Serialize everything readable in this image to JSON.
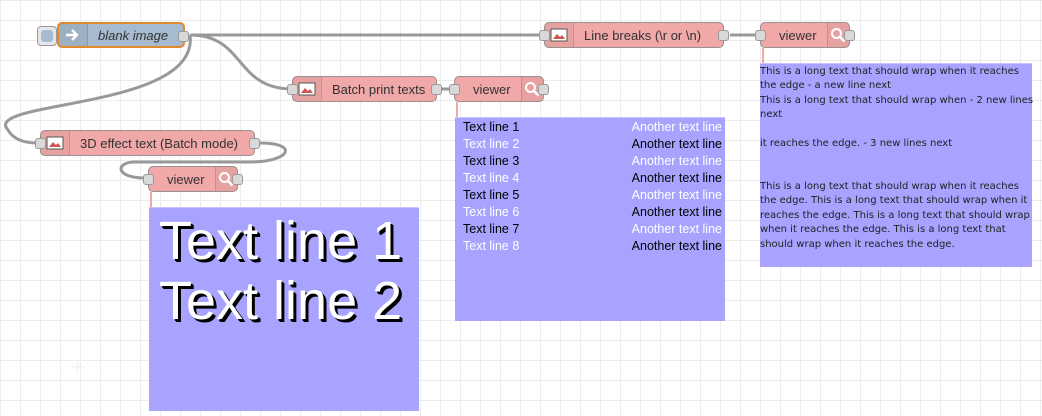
{
  "nodes": {
    "inject": {
      "label": "blank image",
      "icon": "arrow-right-icon"
    },
    "line_breaks": {
      "label": "Line breaks (\\r or \\n)",
      "icon": "image-icon"
    },
    "batch_print": {
      "label": "Batch print texts",
      "icon": "image-icon"
    },
    "effect_3d": {
      "label": "3D effect text (Batch mode)",
      "icon": "image-icon"
    },
    "viewer_1": {
      "label": "viewer",
      "icon": "search-icon"
    },
    "viewer_2": {
      "label": "viewer",
      "icon": "search-icon"
    },
    "viewer_3": {
      "label": "viewer",
      "icon": "search-icon"
    }
  },
  "viewer_3d": {
    "lines": [
      "Text line 1",
      "Text line 2"
    ]
  },
  "viewer_batch": {
    "left": [
      "Text line 1",
      "Text line 2",
      "Text line 3",
      "Text line 4",
      "Text line 5",
      "Text line 6",
      "Text line 7",
      "Text line 8"
    ],
    "right": [
      "Another text line",
      "Another text line",
      "Another text line",
      "Another text line",
      "Another text line",
      "Another text line",
      "Another text line",
      "Another text line"
    ]
  },
  "viewer_wrap": {
    "block1": "This is a long text that should wrap when it reaches the edge - a new line next",
    "block2": "This is a long text that should wrap when - 2 new lines next",
    "block3": "it reaches the edge. - 3 new lines next",
    "block4": "This is a long text that should wrap when it reaches the edge. This is a long text that should wrap when it reaches the edge. This is a long text that should wrap when it reaches the edge. This is a long text that should wrap when it reaches the edge."
  },
  "colors": {
    "node_function": "#f0a8a8",
    "node_inject": "#a6bbcf",
    "selection_border": "#e08a2e",
    "viewer_bg": "#a8a3ff",
    "wire": "#999999"
  }
}
